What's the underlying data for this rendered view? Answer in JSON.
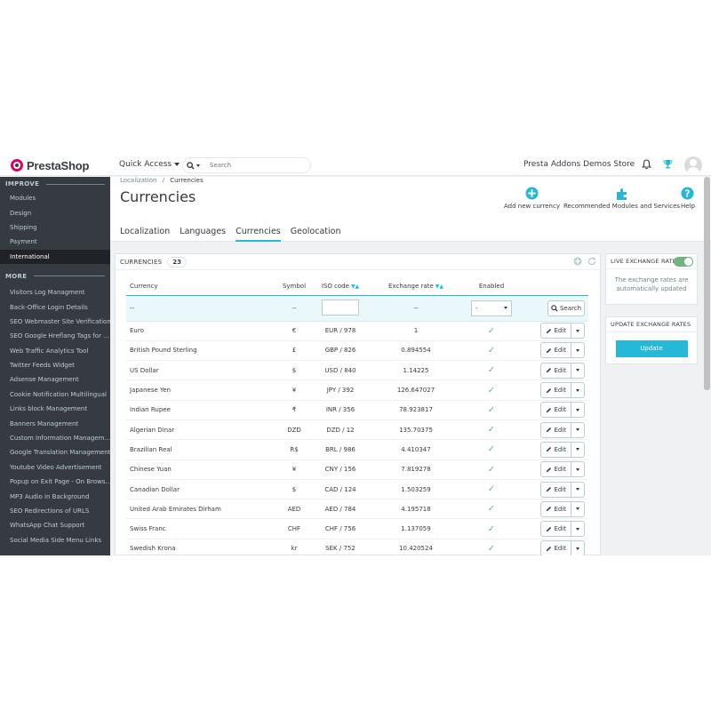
{
  "header": {
    "logo_text": "PrestaShop",
    "quick_access": "Quick Access",
    "search_placeholder": "Search",
    "store_name": "Presta Addons Demos Store"
  },
  "sidebar": {
    "improve_label": "IMPROVE",
    "improve_items": [
      "Modules",
      "Design",
      "Shipping",
      "Payment",
      "International"
    ],
    "more_label": "MORE",
    "more_items": [
      "Visitors Log Managment",
      "Back-Office Login Details",
      "SEO Webmaster Site Verification",
      "SEO Google Hreflang Tags for ...",
      "Web Traffic Analytics Tool",
      "Twitter Feeds Widget",
      "Adsense Management",
      "Cookie Notification Multilingual",
      "Links block Management",
      "Banners Management",
      "Custom Information Managem...",
      "Google Translation Management",
      "Youtube Video Advertisement",
      "Popup on Exit Page - On Brows...",
      "MP3 Audio in Background",
      "SEO Redirections of URLS",
      "WhatsApp Chat Support",
      "Social Media Side Menu Links"
    ]
  },
  "page": {
    "breadcrumb_parent": "Localization",
    "breadcrumb_sep": "/",
    "breadcrumb_current": "Currencies",
    "title": "Currencies",
    "toolbar": {
      "add": "Add new currency",
      "recommended": "Recommended Modules and Services",
      "help": "Help"
    },
    "tabs": [
      "Localization",
      "Languages",
      "Currencies",
      "Geolocation"
    ],
    "active_tab": 2
  },
  "panel": {
    "title": "CURRENCIES",
    "count": "23",
    "columns": {
      "currency": "Currency",
      "symbol": "Symbol",
      "iso": "ISO code",
      "rate": "Exchange rate",
      "enabled": "Enabled"
    },
    "filter": {
      "currency": "--",
      "symbol": "--",
      "rate": "--",
      "enabled_value": "-",
      "search_label": "Search"
    },
    "edit_label": "Edit",
    "rows": [
      {
        "name": "Euro",
        "symbol": "€",
        "iso": "EUR / 978",
        "rate": "1"
      },
      {
        "name": "British Pound Sterling",
        "symbol": "£",
        "iso": "GBP / 826",
        "rate": "0.894554"
      },
      {
        "name": "US Dollar",
        "symbol": "$",
        "iso": "USD / 840",
        "rate": "1.14225"
      },
      {
        "name": "Japanese Yen",
        "symbol": "¥",
        "iso": "JPY / 392",
        "rate": "126.647027"
      },
      {
        "name": "Indian Rupee",
        "symbol": "₹",
        "iso": "INR / 356",
        "rate": "78.923817"
      },
      {
        "name": "Algerian Dinar",
        "symbol": "DZD",
        "iso": "DZD / 12",
        "rate": "135.70375"
      },
      {
        "name": "Brazilian Real",
        "symbol": "R$",
        "iso": "BRL / 986",
        "rate": "4.410347"
      },
      {
        "name": "Chinese Yuan",
        "symbol": "¥",
        "iso": "CNY / 156",
        "rate": "7.819278"
      },
      {
        "name": "Canadian Dollar",
        "symbol": "$",
        "iso": "CAD / 124",
        "rate": "1.503259"
      },
      {
        "name": "United Arab Emirates Dirham",
        "symbol": "AED",
        "iso": "AED / 784",
        "rate": "4.195718"
      },
      {
        "name": "Swiss Franc",
        "symbol": "CHF",
        "iso": "CHF / 756",
        "rate": "1.137059"
      },
      {
        "name": "Swedish Krona",
        "symbol": "kr",
        "iso": "SEK / 752",
        "rate": "10.420524"
      }
    ]
  },
  "live_rates": {
    "title": "LIVE EXCHANGE RATES",
    "enabled": true,
    "text": "The exchange rates are automatically updated"
  },
  "update_rates": {
    "title": "UPDATE EXCHANGE RATES",
    "button": "Update"
  },
  "colors": {
    "accent": "#25b9d7",
    "sidebar_bg": "#363a41",
    "success": "#70b580",
    "brand": "#df0067"
  }
}
